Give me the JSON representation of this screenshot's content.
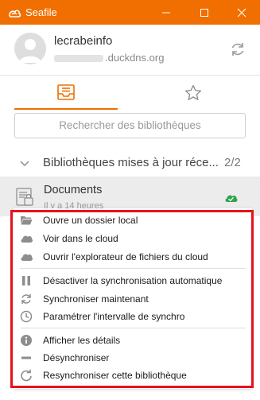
{
  "window": {
    "title": "Seafile"
  },
  "account": {
    "username": "lecrabeinfo",
    "server_suffix": ".duckdns.org"
  },
  "search": {
    "placeholder": "Rechercher des bibliothèques"
  },
  "group": {
    "title": "Bibliothèques mises à jour réce...",
    "count": "2/2"
  },
  "repo": {
    "name": "Documents",
    "time": "Il y a 14 heures"
  },
  "context_menu": {
    "items": [
      {
        "label": "Ouvre un dossier local",
        "icon": "folder-icon"
      },
      {
        "label": "Voir dans le cloud",
        "icon": "cloud-icon"
      },
      {
        "label": "Ouvrir l'explorateur de fichiers du cloud",
        "icon": "cloud-icon"
      },
      {
        "label": "Désactiver la synchronisation automatique",
        "icon": "pause-icon"
      },
      {
        "label": "Synchroniser maintenant",
        "icon": "sync-icon"
      },
      {
        "label": "Paramétrer l'intervalle de synchro",
        "icon": "clock-icon"
      },
      {
        "label": "Afficher les détails",
        "icon": "info-icon"
      },
      {
        "label": "Désynchroniser",
        "icon": "minus-icon"
      },
      {
        "label": "Resynchroniser cette bibliothèque",
        "icon": "resync-icon"
      }
    ]
  },
  "colors": {
    "accent": "#f06f00",
    "annotation": "#e8121c",
    "status_ok": "#2ea44f"
  }
}
